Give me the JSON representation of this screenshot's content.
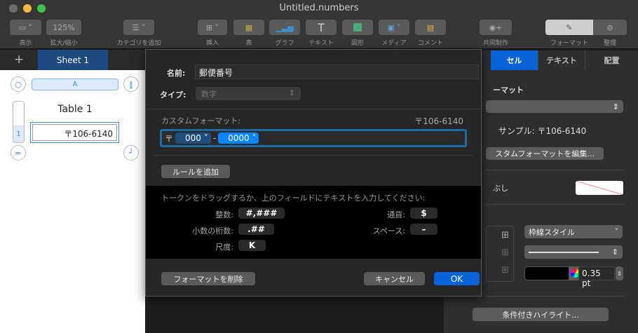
{
  "window": {
    "title": "Untitled.numbers"
  },
  "toolbar": {
    "items": [
      {
        "label": "表示",
        "icon": "view-icon"
      },
      {
        "label": "拡大/縮小",
        "value": "125%",
        "icon": "zoom-icon"
      },
      {
        "label": "カテゴリを追加",
        "icon": "category-icon"
      },
      {
        "label": "挿入",
        "icon": "insert-icon"
      },
      {
        "label": "表",
        "icon": "table-icon"
      },
      {
        "label": "グラフ",
        "icon": "chart-icon"
      },
      {
        "label": "テキスト",
        "icon": "text-icon",
        "glyph": "T"
      },
      {
        "label": "図形",
        "icon": "shape-icon"
      },
      {
        "label": "メディア",
        "icon": "media-icon"
      },
      {
        "label": "コメント",
        "icon": "comment-icon"
      },
      {
        "label": "共同制作",
        "icon": "collaborate-icon"
      },
      {
        "label": "フォーマット",
        "icon": "format-icon"
      },
      {
        "label": "整理",
        "icon": "organize-icon"
      }
    ]
  },
  "sheets": {
    "add": "+",
    "active": "Sheet 1"
  },
  "table": {
    "title": "Table 1",
    "column": "A",
    "row": "1",
    "cell": "〒106-6140"
  },
  "dialog": {
    "name_label": "名前:",
    "name_value": "郵便番号",
    "type_label": "タイプ:",
    "type_value": "数字",
    "custom_label": "カスタムフォーマット:",
    "preview": "〒106-6140",
    "format_prefix": "〒",
    "token1": "000",
    "separator": "-",
    "token2": "0000",
    "add_rule": "ルールを追加",
    "hint": "トークンをドラッグするか、上のフィールドにテキストを入力してください:",
    "tokens": [
      {
        "label": "整数:",
        "value": "#,###"
      },
      {
        "label": "小数の桁数:",
        "value": ".##"
      },
      {
        "label": "尺度:",
        "value": "K"
      },
      {
        "label": "通貨:",
        "value": "$"
      },
      {
        "label": "スペース:",
        "value": "–"
      }
    ],
    "delete": "フォーマットを削除",
    "cancel": "キャンセル",
    "ok": "OK"
  },
  "panel": {
    "tabs": [
      "セル",
      "テキスト",
      "配置"
    ],
    "format_heading": "ーマット",
    "sample": "サンプル: 〒106-6140",
    "edit_custom": "スタムフォーマットを編集...",
    "fill_label": "ぶし",
    "border_style": "枠線スタイル",
    "border_width": "0.35 pt",
    "conditional": "条件付きハイライト..."
  },
  "colors": {
    "accent": "#0a63d8",
    "token_selected": "#0a84ff",
    "token": "#1f4f7d"
  }
}
